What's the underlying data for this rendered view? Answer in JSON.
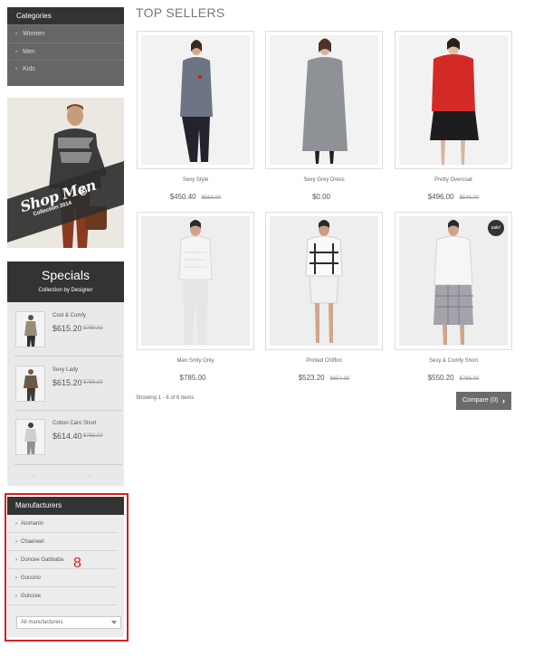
{
  "categories": {
    "title": "Categories",
    "items": [
      {
        "label": "Women"
      },
      {
        "label": "Men"
      },
      {
        "label": "Kids"
      }
    ]
  },
  "banner": {
    "headline": "Shop Men",
    "subline": "Collection 2014"
  },
  "specials": {
    "title": "Specials",
    "subtitle": "Collection by Designer",
    "items": [
      {
        "name": "Cool & Comfy",
        "price": "$615.20",
        "old_price": "$769.00"
      },
      {
        "name": "Sexy Lady",
        "price": "$615.20",
        "old_price": "$769.00"
      },
      {
        "name": "Cotton Caro Short",
        "price": "$614.40",
        "old_price": "$768.00"
      }
    ],
    "prev_label": "←",
    "next_label": "→"
  },
  "manufacturers": {
    "title": "Manufacturers",
    "items": [
      {
        "label": "Aiomanin"
      },
      {
        "label": "Chaeneel"
      },
      {
        "label": "Doncee Gabbaba"
      },
      {
        "label": "Guccino"
      },
      {
        "label": "Guiccee"
      }
    ],
    "select_value": "All manufacturers"
  },
  "annotation": "8",
  "main": {
    "title": "TOP SELLERS",
    "products": [
      {
        "name": "Sexy Style",
        "price": "$450.40",
        "old_price": "$563.00"
      },
      {
        "name": "Sexy Grey Dress",
        "price": "$0.00",
        "old_price": ""
      },
      {
        "name": "Pretty Overcoat",
        "price": "$496.00",
        "old_price": "$546.00"
      },
      {
        "name": "Men Smfy Only",
        "price": "$785.00",
        "old_price": ""
      },
      {
        "name": "Printed Chiffon",
        "price": "$523.20",
        "old_price": "$654.00"
      },
      {
        "name": "Sexy & Comfy Short",
        "price": "$550.20",
        "old_price": "$786.00",
        "badge": "sale!"
      }
    ],
    "showing": "Showing 1 - 6 of 6 items",
    "compare_label": "Compare (0)"
  },
  "colors": {
    "dark_header": "#333333",
    "category_bg": "#666666",
    "compare_button": "#6b6b6b",
    "highlight": "#d9201f",
    "overcoat_red": "#d42a25"
  },
  "icons": {
    "category_bullet": "bullet-icon",
    "manufacturer_chevron": "chevron-right-icon",
    "compare_chevron": "chevron-right-icon",
    "banner_play": "play-circle-icon",
    "select_caret": "caret-down-icon"
  }
}
